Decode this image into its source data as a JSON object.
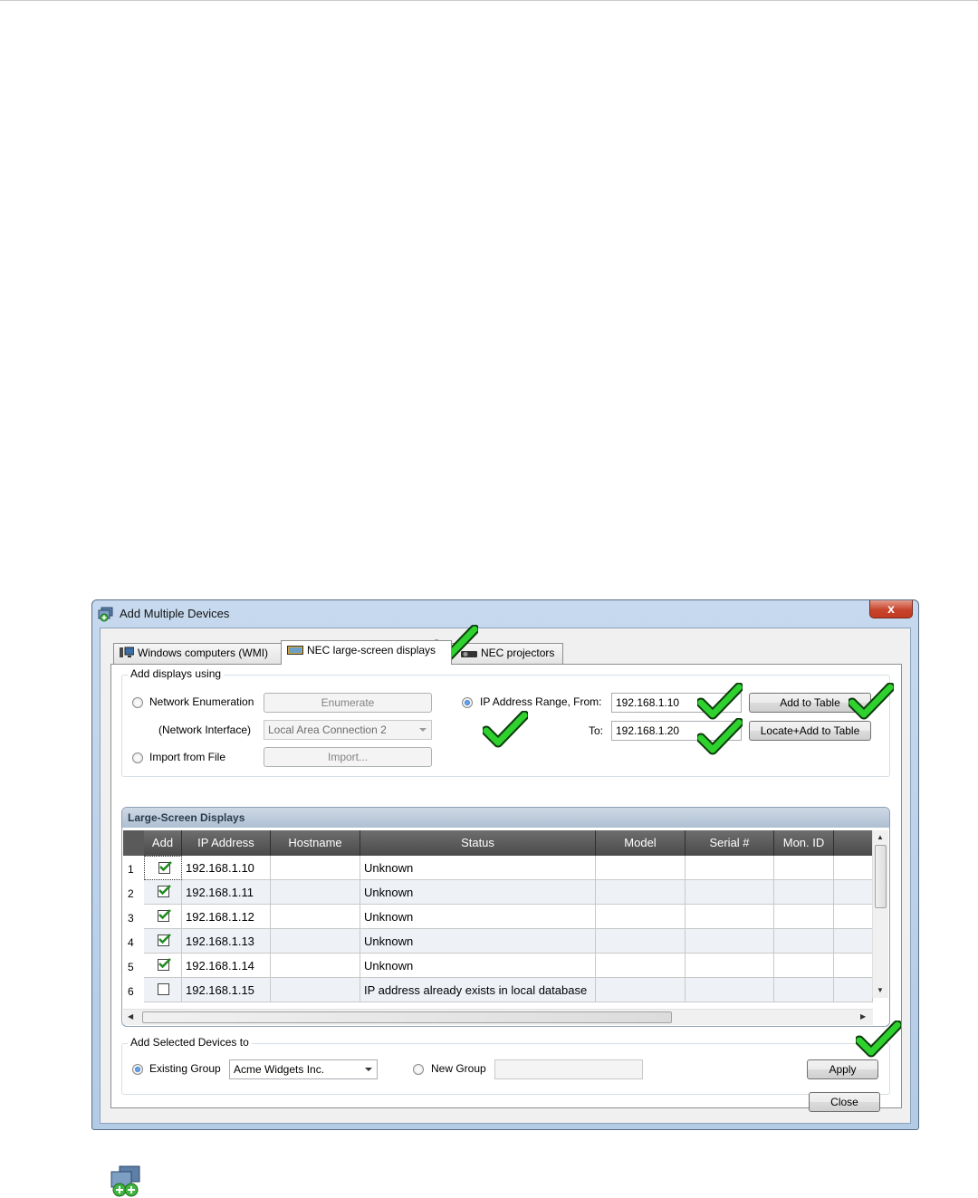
{
  "window": {
    "title": "Add Multiple Devices",
    "close_glyph": "x"
  },
  "tabs": [
    {
      "label": "Windows computers (WMI)",
      "icon": "computer-icon"
    },
    {
      "label": "NEC large-screen displays",
      "icon": "display-icon"
    },
    {
      "label": "NEC projectors",
      "icon": "projector-icon"
    }
  ],
  "add_displays": {
    "legend": "Add displays using",
    "network_enumeration": "Network Enumeration",
    "enumerate_btn": "Enumerate",
    "network_interface_label": "(Network Interface)",
    "network_interface_value": "Local Area Connection 2",
    "import_from_file": "Import from File",
    "import_btn": "Import...",
    "ip_range_label": "IP Address Range, From:",
    "to_label": "To:",
    "from_value": "192.168.1.10",
    "to_value": "192.168.1.20",
    "add_to_table_btn": "Add to Table",
    "locate_add_btn": "Locate+Add to Table",
    "selected_method": "ip-range"
  },
  "grid": {
    "caption": "Large-Screen Displays",
    "columns": [
      "Add",
      "IP Address",
      "Hostname",
      "Status",
      "Model",
      "Serial #",
      "Mon. ID"
    ],
    "rows": [
      {
        "num": "1",
        "checked": true,
        "ip": "192.168.1.10",
        "host": "",
        "status": "Unknown"
      },
      {
        "num": "2",
        "checked": true,
        "ip": "192.168.1.11",
        "host": "",
        "status": "Unknown"
      },
      {
        "num": "3",
        "checked": true,
        "ip": "192.168.1.12",
        "host": "",
        "status": "Unknown"
      },
      {
        "num": "4",
        "checked": true,
        "ip": "192.168.1.13",
        "host": "",
        "status": "Unknown"
      },
      {
        "num": "5",
        "checked": true,
        "ip": "192.168.1.14",
        "host": "",
        "status": "Unknown"
      },
      {
        "num": "6",
        "checked": false,
        "ip": "192.168.1.15",
        "host": "",
        "status": "IP address already exists in local database"
      }
    ]
  },
  "add_selected": {
    "legend": "Add Selected Devices to",
    "existing_group": "Existing Group",
    "existing_group_value": "Acme Widgets Inc.",
    "new_group": "New Group",
    "new_group_value": "",
    "apply_btn": "Apply",
    "selected": "existing"
  },
  "close_btn": "Close",
  "colors": {
    "check_green": "#2fd12f",
    "check_outline": "#0d3d0d",
    "grid_header": "#555555",
    "row_alt": "#eef2f7"
  }
}
